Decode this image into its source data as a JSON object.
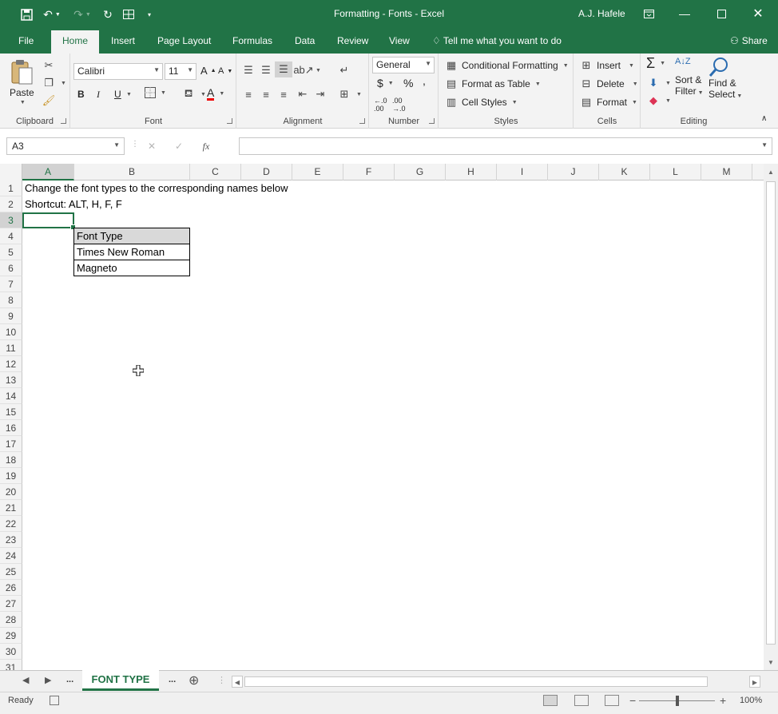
{
  "titlebar": {
    "title": "Formatting - Fonts  -  Excel",
    "user": "A.J. Hafele"
  },
  "tabs": [
    "File",
    "Home",
    "Insert",
    "Page Layout",
    "Formulas",
    "Data",
    "Review",
    "View"
  ],
  "tell_me": "Tell me what you want to do",
  "share": "Share",
  "ribbon": {
    "clipboard": {
      "label": "Clipboard",
      "paste": "Paste"
    },
    "font": {
      "label": "Font",
      "font_name": "Calibri",
      "font_size": "11",
      "bold": "B",
      "italic": "I",
      "underline": "U"
    },
    "alignment": {
      "label": "Alignment"
    },
    "number": {
      "label": "Number",
      "format": "General",
      "currency": "$",
      "percent": "%",
      "comma": ","
    },
    "styles": {
      "label": "Styles",
      "conditional": "Conditional Formatting",
      "format_table": "Format as Table",
      "cell_styles": "Cell Styles"
    },
    "cells": {
      "label": "Cells",
      "insert": "Insert",
      "delete": "Delete",
      "format": "Format"
    },
    "editing": {
      "label": "Editing",
      "sort_filter_1": "Sort &",
      "sort_filter_2": "Filter",
      "find_select_1": "Find &",
      "find_select_2": "Select"
    }
  },
  "namebox": "A3",
  "fx": "fx",
  "columns": [
    "A",
    "B",
    "C",
    "D",
    "E",
    "F",
    "G",
    "H",
    "I",
    "J",
    "K",
    "L",
    "M"
  ],
  "rows": [
    "1",
    "2",
    "3",
    "4",
    "5",
    "6",
    "7",
    "8",
    "9",
    "10",
    "11",
    "12",
    "13",
    "14",
    "15",
    "16",
    "17",
    "18",
    "19",
    "20",
    "21",
    "22",
    "23",
    "24",
    "25",
    "26",
    "27",
    "28",
    "29",
    "30",
    "31"
  ],
  "cells": {
    "a1": "Change the font types to the corresponding names below",
    "a2": "Shortcut: ALT, H, F, F",
    "b4": "Font Type",
    "b5": "Times New Roman",
    "b6": "Magneto"
  },
  "sheet": {
    "nav_more": "...",
    "tab": "FONT TYPE",
    "more_right": "..."
  },
  "status": {
    "ready": "Ready",
    "zoom": "100%"
  },
  "colors": {
    "accent": "#217346",
    "header_fill": "#d9d9d9"
  }
}
